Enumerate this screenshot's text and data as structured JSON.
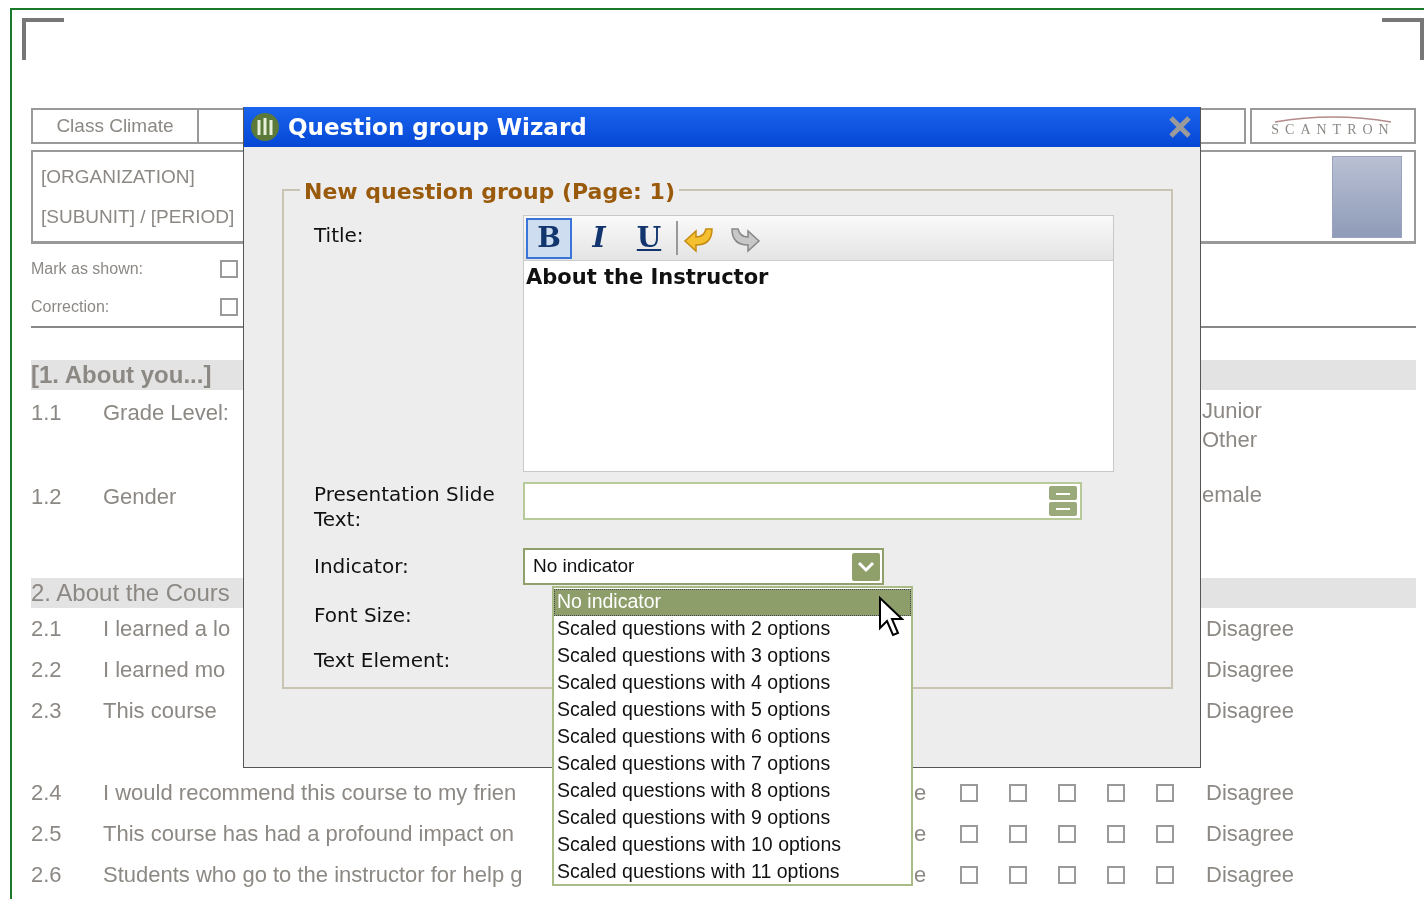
{
  "form": {
    "header_title": "Class Climate",
    "logo": "SCANTRON",
    "organization": "[ORGANIZATION]",
    "subunit_period": "[SUBUNIT] / [PERIOD]",
    "flags": [
      {
        "label": "Mark as shown:",
        "checked": false
      },
      {
        "label": "Correction:",
        "checked": false
      }
    ]
  },
  "sections": [
    {
      "title": "[1. About you...]",
      "kind": "bold",
      "questions": [
        {
          "number": "1.1",
          "text": "Grade Level:",
          "options": [
            "Junior",
            "Other"
          ]
        },
        {
          "number": "1.2",
          "text": "Gender",
          "options": [
            "emale"
          ]
        }
      ]
    },
    {
      "title": "2. About the Cours",
      "kind": "plain",
      "questions": [
        {
          "number": "2.1",
          "text": "I learned a lo",
          "scale_end": "Disagree"
        },
        {
          "number": "2.2",
          "text": "I learned mo",
          "scale_end": "Disagree"
        },
        {
          "number": "2.3",
          "text": "This course",
          "scale_end": "Disagree"
        },
        {
          "number": "2.4",
          "text": "I would recommend this course to my frien",
          "scale_start": "e",
          "boxes": [
            {
              "checked": false
            },
            {
              "checked": false
            },
            {
              "checked": false
            },
            {
              "checked": false
            },
            {
              "checked": false
            }
          ],
          "scale_end": "Disagree"
        },
        {
          "number": "2.5",
          "text": "This course has had a profound impact on",
          "scale_start": "e",
          "boxes": [
            {
              "checked": false
            },
            {
              "checked": false
            },
            {
              "checked": false
            },
            {
              "checked": false
            },
            {
              "checked": false
            }
          ],
          "scale_end": "Disagree"
        },
        {
          "number": "2.6",
          "text": "Students who go to the instructor for help g",
          "scale_start": "e",
          "boxes": [
            {
              "checked": false
            },
            {
              "checked": false
            },
            {
              "checked": false
            },
            {
              "checked": false
            },
            {
              "checked": false
            }
          ],
          "scale_end": "Disagree"
        }
      ]
    }
  ],
  "dialog": {
    "title": "Question group Wizard",
    "legend": "New question group (Page: 1)",
    "title_label": "Title:",
    "toolbar": [
      {
        "kind": "bold",
        "label": "B",
        "selected": true
      },
      {
        "kind": "italic",
        "label": "I",
        "selected": false
      },
      {
        "kind": "underline",
        "label": "U",
        "selected": false
      },
      {
        "kind": "undo",
        "disabled": false
      },
      {
        "kind": "redo",
        "disabled": true
      }
    ],
    "title_value": "About the Instructor",
    "slide_label": "Presentation Slide Text:",
    "indicator_label": "Indicator:",
    "indicator_value": "No indicator",
    "indicator_expanded": true,
    "font_size_label": "Font Size:",
    "text_element_label": "Text Element:",
    "indicator_options": [
      {
        "label": "No indicator",
        "selected": true
      },
      {
        "label": "Scaled questions with 2 options",
        "selected": false
      },
      {
        "label": "Scaled questions with 3 options",
        "selected": false
      },
      {
        "label": "Scaled questions with 4 options",
        "selected": false
      },
      {
        "label": "Scaled questions with 5 options",
        "selected": false
      },
      {
        "label": "Scaled questions with 6 options",
        "selected": false
      },
      {
        "label": "Scaled questions with 7 options",
        "selected": false
      },
      {
        "label": "Scaled questions with 8 options",
        "selected": false
      },
      {
        "label": "Scaled questions with 9 options",
        "selected": false
      },
      {
        "label": "Scaled questions with 10 options",
        "selected": false
      },
      {
        "label": "Scaled questions with 11 options",
        "selected": false
      }
    ]
  }
}
